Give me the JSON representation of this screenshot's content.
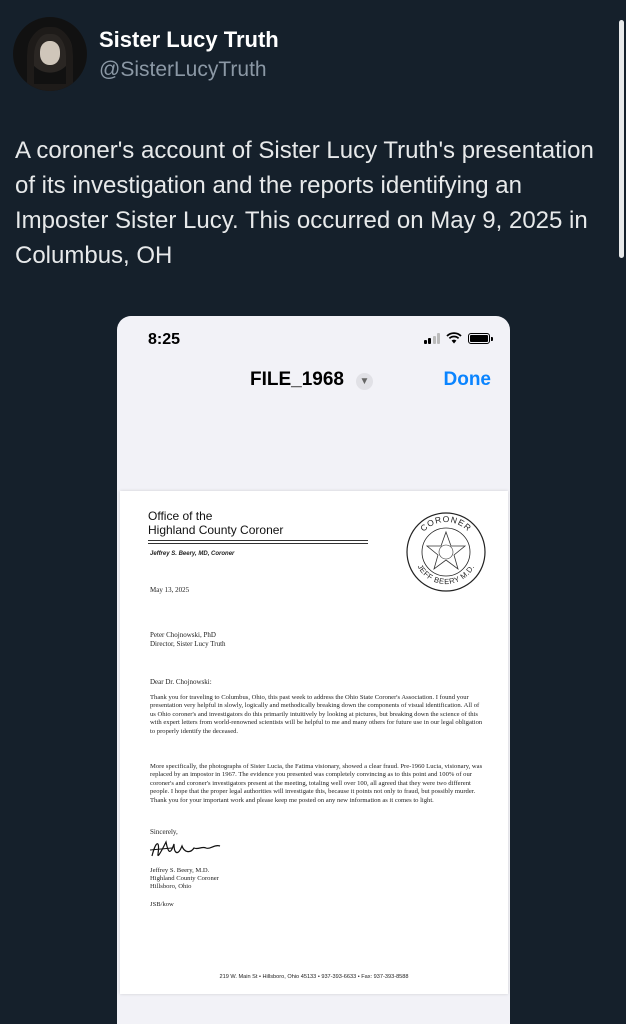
{
  "post": {
    "display_name": "Sister Lucy Truth",
    "handle": "@SisterLucyTruth",
    "text": "A coroner's account of Sister Lucy Truth's presentation of its investigation and the reports identifying an Imposter Sister Lucy. This occurred on May 9, 2025 in Columbus, OH"
  },
  "phone": {
    "time": "8:25",
    "file_name": "FILE_1968",
    "done_label": "Done"
  },
  "letter": {
    "office_line1": "Office of the",
    "office_line2": "Highland County Coroner",
    "byline": "Jeffrey S. Beery, MD, Coroner",
    "seal_top": "CORONER",
    "seal_bottom": "JEFF BEERY M.D.",
    "date": "May 13, 2025",
    "recipient_name": "Peter Chojnowski, PhD",
    "recipient_title": "Director, Sister Lucy Truth",
    "greeting": "Dear Dr. Chojnowski:",
    "paragraph1": "Thank you for traveling to Columbus, Ohio, this past week to address the Ohio State Coroner's Association. I found your presentation very helpful in slowly, logically and methodically breaking down the components of visual identification. All of us Ohio coroner's and investigators do this primarily intuitively by looking at pictures, but breaking down the science of this with expert letters from world-renowned scientists will be helpful to me and many others for future use in our legal obligation to properly identify the deceased.",
    "paragraph2": "More specifically, the photographs of Sister Lucia, the Fatima visionary, showed a clear fraud. Pre-1960 Lucia, visionary, was replaced by an impostor in 1967. The evidence you presented was completely convincing as to this point and 100% of our coroner's and coroner's investigators present at the meeting, totaling well over 100, all agreed that they were two different people. I hope that the proper legal authorities will investigate this, because it points not only to fraud, but possibly murder. Thank you for your important work and please keep me posted on any new information as it comes to light.",
    "closing": "Sincerely,",
    "sign_name": "Jeffrey S. Beery, M.D.",
    "sign_title": "Highland County Coroner",
    "sign_city": "Hillsboro, Ohio",
    "initials": "JSB/kow",
    "footer": "219 W. Main St  •  Hillsboro, Ohio 45133  •  937-393-6633  •  Fax: 937-393-8588"
  }
}
